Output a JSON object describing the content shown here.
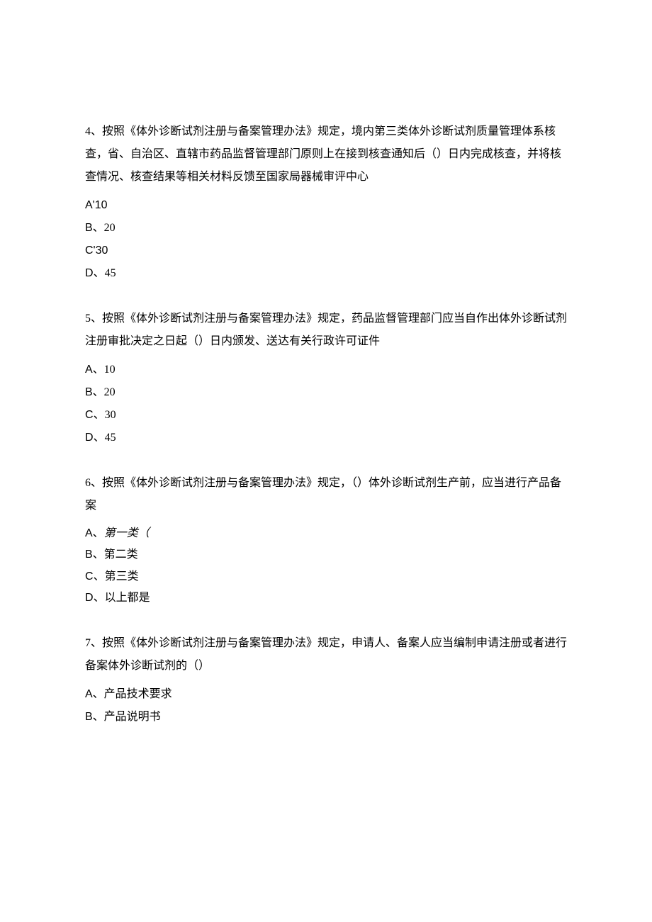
{
  "q4": {
    "stem": "4、按照《体外诊断试剂注册与备案管理办法》规定，境内第三类体外诊断试剂质量管理体系核查，省、自治区、直辖市药品监督管理部门原则上在接到核查通知后（）日内完成核查，并将核查情况、核查结果等相关材料反馈至国家局器械审评中心",
    "a": "A'10",
    "b": "B、20",
    "c": "C'30",
    "d": "D、45"
  },
  "q5": {
    "stem": "5、按照《体外诊断试剂注册与备案管理办法》规定，药品监督管理部门应当自作出体外诊断试剂注册审批决定之日起（）日内颁发、送达有关行政许可证件",
    "a": "A、10",
    "b": "B、20",
    "c": "C、30",
    "d": "D、45"
  },
  "q6": {
    "stem": "6、按照《体外诊断试剂注册与备案管理办法》规定，（）体外诊断试剂生产前，应当进行产品备案",
    "a_prefix": "A、",
    "a_ital": "第一类（",
    "b": "B、第二类",
    "c": "C、第三类",
    "d": "D、以上都是"
  },
  "q7": {
    "stem": "7、按照《体外诊断试剂注册与备案管理办法》规定，申请人、备案人应当编制申请注册或者进行备案体外诊断试剂的（）",
    "a": "A、产品技术要求",
    "b": "B、产品说明书"
  }
}
